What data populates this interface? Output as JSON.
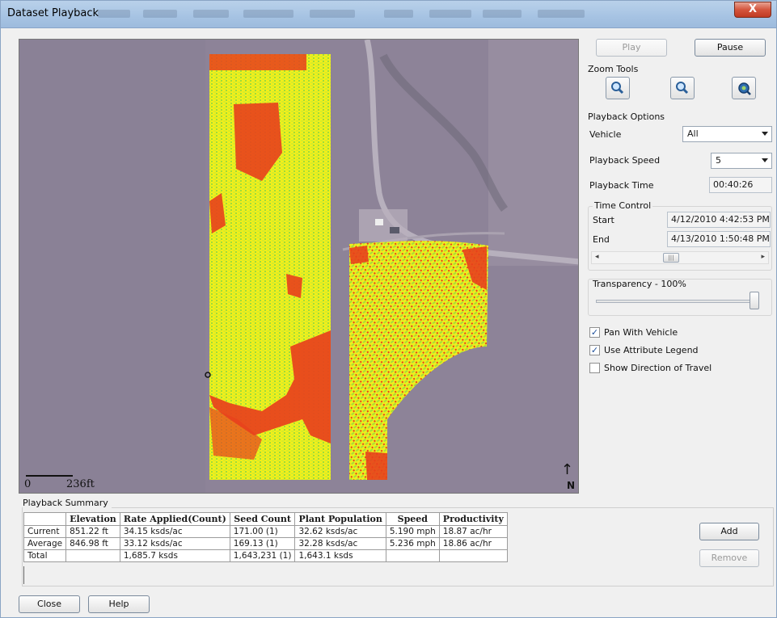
{
  "window": {
    "title": "Dataset Playback",
    "close_glyph": "X"
  },
  "controls": {
    "play_label": "Play",
    "pause_label": "Pause",
    "zoom_tools_label": "Zoom Tools",
    "zoom_icons": [
      "zoom-in-icon",
      "zoom-out-icon",
      "zoom-extent-icon"
    ],
    "playback_options_label": "Playback Options",
    "vehicle_label": "Vehicle",
    "vehicle_value": "All",
    "playback_speed_label": "Playback Speed",
    "playback_speed_value": "5",
    "playback_time_label": "Playback Time",
    "playback_time_value": "00:40:26",
    "time_control_label": "Time Control",
    "start_label": "Start",
    "start_value": "4/12/2010 4:42:53 PM",
    "end_label": "End",
    "end_value": "4/13/2010 1:50:48 PM",
    "transparency_label": "Transparency - 100%",
    "transparency_level": 1.0,
    "pan_with_vehicle_label": "Pan With Vehicle",
    "pan_with_vehicle_checked": true,
    "use_attribute_legend_label": "Use Attribute Legend",
    "use_attribute_legend_checked": true,
    "show_direction_label": "Show Direction of Travel",
    "show_direction_checked": false
  },
  "map": {
    "scale_zero": "0",
    "scale_distance": "236ft",
    "north_label": "N",
    "colors": {
      "background": "#8d8398",
      "high": "#e8401c",
      "mid": "#f2ef1a",
      "low": "#7fd13b",
      "road": "#b7b0bd"
    }
  },
  "summary": {
    "title": "Playback Summary",
    "columns": [
      "",
      "Elevation",
      "Rate Applied(Count)",
      "Seed Count",
      "Plant Population",
      "Speed",
      "Productivity"
    ],
    "rows": [
      [
        "Current",
        "851.22 ft",
        "34.15 ksds/ac",
        "171.00 (1)",
        "32.62 ksds/ac",
        "5.190 mph",
        "18.87 ac/hr"
      ],
      [
        "Average",
        "846.98 ft",
        "33.12 ksds/ac",
        "169.13 (1)",
        "32.28 ksds/ac",
        "5.236 mph",
        "18.86 ac/hr"
      ],
      [
        "Total",
        "",
        "1,685.7 ksds",
        "1,643,231 (1)",
        "1,643.1 ksds",
        "",
        ""
      ]
    ],
    "add_label": "Add",
    "remove_label": "Remove"
  },
  "footer": {
    "close_label": "Close",
    "help_label": "Help"
  }
}
